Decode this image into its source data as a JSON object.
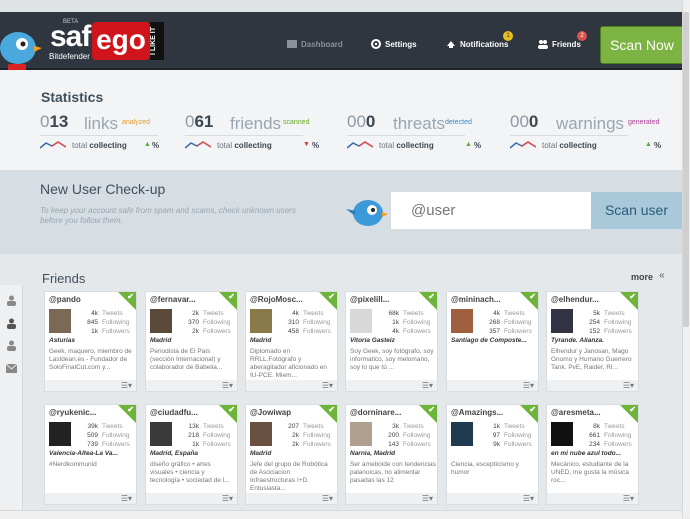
{
  "brand": {
    "product": "saf",
    "beta": "BETA",
    "company": "Bitdefender",
    "ego": "ego",
    "tagline": "I LIKE IT"
  },
  "nav": {
    "dashboard": "Dashboard",
    "settings": "Settings",
    "notifications": "Notifications",
    "notifications_count": "1",
    "friends": "Friends",
    "friends_count": "2",
    "scan_now": "Scan Now"
  },
  "statistics": {
    "title": "Statistics",
    "items": [
      {
        "prefix": "0",
        "value": "13",
        "label": "links",
        "tag": "analyzed",
        "tag_color": "#e0a030",
        "total": "total",
        "collecting": "collecting",
        "trend": "up",
        "pct": "%"
      },
      {
        "prefix": "0",
        "value": "61",
        "label": "friends",
        "tag": "scanned",
        "tag_color": "#6aaa2a",
        "total": "total",
        "collecting": "collecting",
        "trend": "down",
        "pct": "%"
      },
      {
        "prefix": "00",
        "value": "0",
        "label": "threats",
        "tag": "detected",
        "tag_color": "#3a8ac0",
        "total": "total",
        "collecting": "collecting",
        "trend": "up",
        "pct": "%"
      },
      {
        "prefix": "00",
        "value": "0",
        "label": "warnings",
        "tag": "generated",
        "tag_color": "#b0409a",
        "total": "total",
        "collecting": "collecting",
        "trend": "up",
        "pct": "%"
      }
    ]
  },
  "checkup": {
    "title": "New User Check-up",
    "description": "To keep your account safe from spam and scams, check unknown users before you follow them.",
    "placeholder": "@user",
    "scan_user": "Scan user"
  },
  "friends": {
    "title": "Friends",
    "more": "more",
    "cards": [
      {
        "handle": "@pando",
        "tweets": "4k",
        "following": "845",
        "followers": "1k",
        "location": "Asturias",
        "bio": "Geek, maquero, miembro de Lastdean.es - Fundador de SoloFinalCut.com y...",
        "avatar": "#7a6a55"
      },
      {
        "handle": "@fernavar...",
        "tweets": "2k",
        "following": "370",
        "followers": "2k",
        "location": "Madrid",
        "bio": "Periodista de El País (sección Internacional) y colaborador de Babelia...",
        "avatar": "#5a4a3a"
      },
      {
        "handle": "@RojoMosc...",
        "tweets": "4k",
        "following": "310",
        "followers": "458",
        "location": "Madrid",
        "bio": "Diplomado en RRLL.Fotógrafo y aberagitador aficionado en IU-PCE. Miem...",
        "avatar": "#8a7a4a"
      },
      {
        "handle": "@pixelill...",
        "tweets": "68k",
        "following": "1k",
        "followers": "4k",
        "location": "Vitoria Gasteiz",
        "bio": "Soy Geek, soy fotógrafo, soy informatico, soy melomano, soy lo que tú ...",
        "avatar": "#d8d8d8"
      },
      {
        "handle": "@mininach...",
        "tweets": "4k",
        "following": "268",
        "followers": "357",
        "location": "Santiago de Composte...",
        "bio": "",
        "avatar": "#a06040"
      },
      {
        "handle": "@elhendur...",
        "tweets": "5k",
        "following": "254",
        "followers": "152",
        "location": "Tyrande. Alianza.",
        "bio": "Elhendur y Janosan, Mago Gnomo y Humano Guerrero Tank. PvE, Raider, Rl...",
        "avatar": "#334"
      },
      {
        "handle": "@ryukenic...",
        "tweets": "39k",
        "following": "509",
        "followers": "739",
        "location": "Valencia-Altea-La Va...",
        "bio": "#Nerdkommunid",
        "avatar": "#222"
      },
      {
        "handle": "@ciudadfu...",
        "tweets": "13k",
        "following": "218",
        "followers": "1k",
        "location": "Madrid, España",
        "bio": "diseño gráfico • artes visuales • ciencia y tecnología • sociedad de l...",
        "avatar": "#3a3a3a"
      },
      {
        "handle": "@Jowiwap",
        "tweets": "207",
        "following": "2k",
        "followers": "2k",
        "location": "Madrid",
        "bio": "Jefe del grupo de Robótica de Asociacion Infraestructuras I+D. Entusiasta...",
        "avatar": "#6a5040"
      },
      {
        "handle": "@dorninare...",
        "tweets": "3k",
        "following": "200",
        "followers": "143",
        "location": "Narnia, Madrid",
        "bio": "Ser ameboide con tendencias palanoicas, no alimentar pasadas las 12",
        "avatar": "#b0a090"
      },
      {
        "handle": "@Amazings...",
        "tweets": "1k",
        "following": "97",
        "followers": "9k",
        "location": "",
        "bio": "Ciencia, escepticismo y humor",
        "avatar": "#203a50"
      },
      {
        "handle": "@aresmeta...",
        "tweets": "8k",
        "following": "661",
        "followers": "234",
        "location": "en mi nube azul todo...",
        "bio": "Mecánico, estudiante de la UNED, me gusta la música roc...",
        "avatar": "#111"
      }
    ],
    "labels": {
      "tweets": "Tweets",
      "following": "Following",
      "followers": "Followers"
    }
  }
}
